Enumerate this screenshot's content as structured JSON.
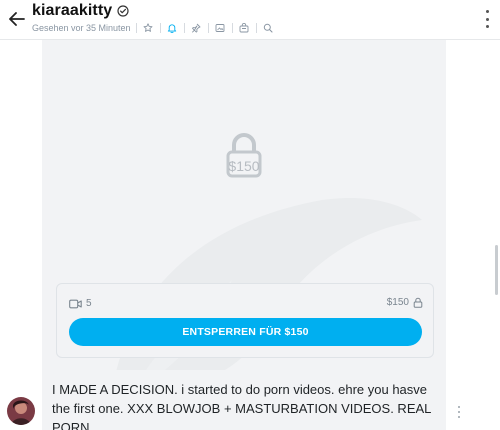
{
  "header": {
    "username": "kiaraakitty",
    "last_seen": "Gesehen vor 35 Minuten",
    "icons": [
      "back-arrow-icon",
      "verified-icon",
      "star-icon",
      "bell-icon",
      "pin-icon",
      "gallery-icon",
      "shop-icon",
      "search-icon",
      "kebab-icon"
    ]
  },
  "message": {
    "locked_price_overlay": "$150",
    "media_count": "5",
    "price": "$150",
    "unlock_label": "ENTSPERREN FÜR $150",
    "text": "I MADE A DECISION. i started to do porn videos. ehre you hasve the first one. XXX BLOWJOB + MASTURBATION VIDEOS. REAL PORN"
  },
  "colors": {
    "accent": "#00aff0",
    "bubble_bg": "#f2f3f5",
    "muted_text": "#8a96a3"
  }
}
